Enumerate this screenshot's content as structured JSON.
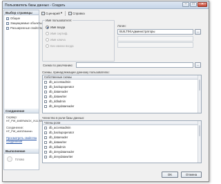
{
  "window": {
    "title": "Пользователь базы данных - Создать"
  },
  "left": {
    "pages_header": "Выбор страницы",
    "pages": [
      "Общие",
      "Защищаемые объекты",
      "Расширенные свойства"
    ],
    "connection_header": "Соединение",
    "server_label": "Сервер:",
    "server_value": "HT_PW_4MERANOX_X\\11.SS",
    "connection_label": "Соединение:",
    "connection_value": "HT_PW_x6432\\Admin",
    "view_link": "Просмотреть свойства соединения",
    "progress_header": "Выполнение",
    "progress_status": "Готово"
  },
  "toolbar": {
    "script_label": "Сценарий",
    "help_label": "Справка"
  },
  "login_group": {
    "title": "Имя пользователя:",
    "options": [
      "Имя входа",
      "Имя сертиф.",
      "Имя ключа",
      "Без имени входа"
    ],
    "login_label": "Логин:",
    "login_value": "BUILTIN\\Администраторы",
    "browse": "...",
    "default_schema_label": "Схема по умолчанию:",
    "default_schema_value": ""
  },
  "owned_schemas": {
    "title": "Схемы, принадлежащие данному пользователю:",
    "column": "Собственные схемы",
    "items": [
      "db_accessadmin",
      "db_backupoperator",
      "db_datareader",
      "db_datawriter",
      "db_ddladmin",
      "db_denydatareader"
    ]
  },
  "role_members": {
    "title": "Членство в роли базы данных:",
    "column": "Члены роли",
    "items": [
      "db_accessadmin",
      "db_backupoperator",
      "db_datareader",
      "db_datawriter",
      "db_ddladmin",
      "db_denydatareader",
      "db_denydatawriter"
    ]
  },
  "buttons": {
    "ok": "OK",
    "cancel": "Отмена"
  }
}
